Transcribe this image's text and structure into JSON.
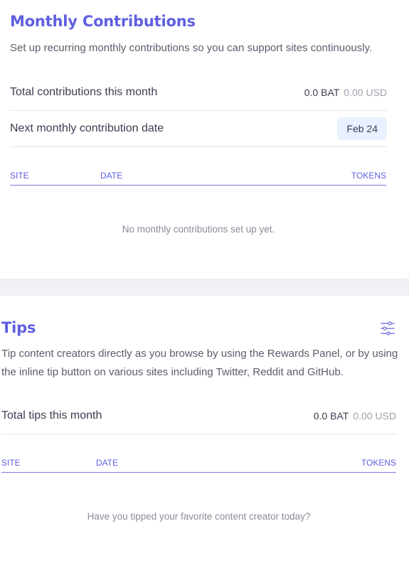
{
  "monthly": {
    "title": "Monthly Contributions",
    "description": "Set up recurring monthly contributions so you can support sites continuously.",
    "total_label": "Total contributions this month",
    "total_bat": "0.0 BAT",
    "total_usd": "0.00 USD",
    "next_date_label": "Next monthly contribution date",
    "next_date_value": "Feb 24",
    "columns": {
      "site": "SITE",
      "date": "DATE",
      "tokens": "TOKENS"
    },
    "empty_text": "No monthly contributions set up yet."
  },
  "tips": {
    "title": "Tips",
    "description": "Tip content creators directly as you browse by using the Rewards Panel, or by using the inline tip button on various sites including Twitter, Reddit and GitHub.",
    "total_label": "Total tips this month",
    "total_bat": "0.0 BAT",
    "total_usd": "0.00 USD",
    "columns": {
      "site": "SITE",
      "date": "DATE",
      "tokens": "TOKENS"
    },
    "empty_text": "Have you tipped your favorite content creator today?",
    "settings_icon": "sliders-icon"
  },
  "colors": {
    "accent": "#5f5fe0",
    "badge_bg": "#e9f0ff",
    "muted": "#9e9fab",
    "section_gap": "#f1f1f5"
  }
}
